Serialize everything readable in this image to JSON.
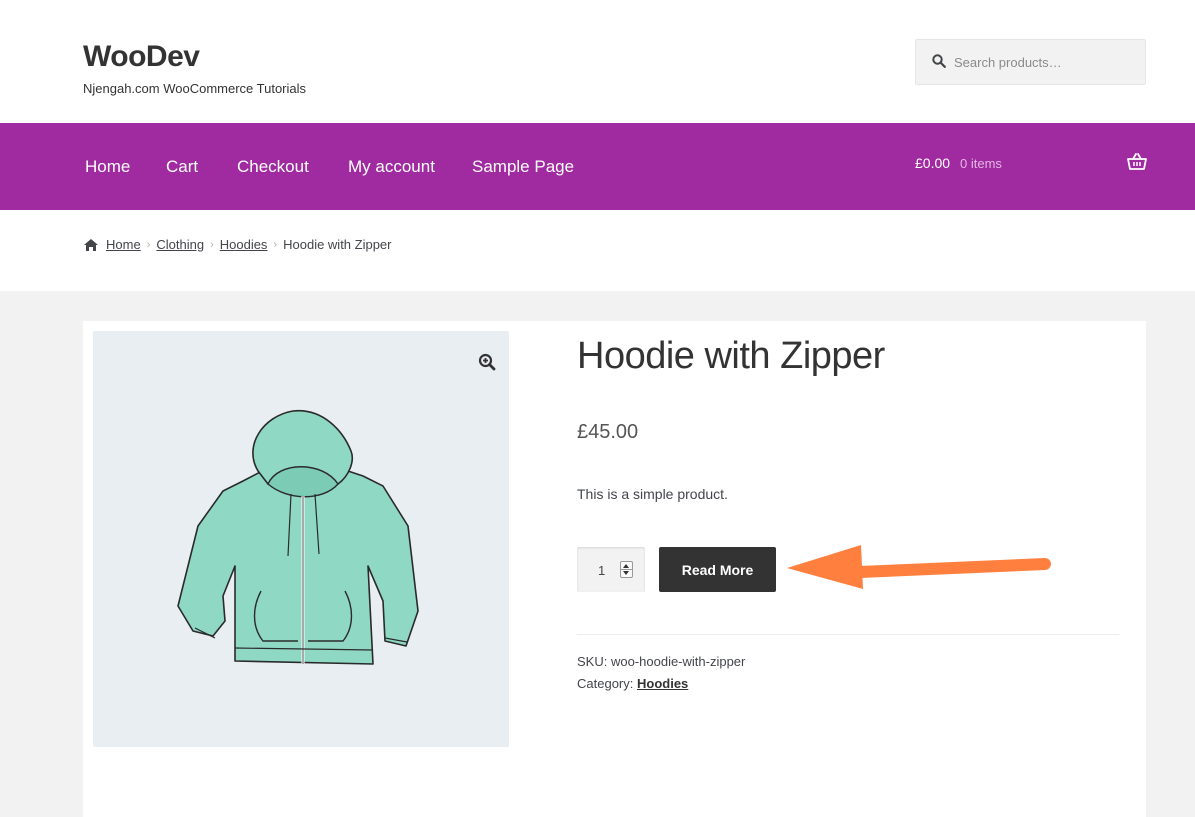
{
  "header": {
    "site_title": "WooDev",
    "site_description": "Njengah.com WooCommerce Tutorials",
    "search": {
      "placeholder": "Search products…",
      "icon": "search-icon"
    }
  },
  "nav": {
    "items": [
      {
        "label": "Home"
      },
      {
        "label": "Cart"
      },
      {
        "label": "Checkout"
      },
      {
        "label": "My account"
      },
      {
        "label": "Sample Page"
      }
    ],
    "cart": {
      "amount": "£0.00",
      "count": "0 items",
      "icon": "basket-icon"
    },
    "background": "#a02aa0"
  },
  "breadcrumb": {
    "icon": "home-icon",
    "links": [
      "Home",
      "Clothing",
      "Hoodies"
    ],
    "current": "Hoodie with Zipper"
  },
  "product": {
    "title": "Hoodie with Zipper",
    "price": "£45.00",
    "short_description": "This is a simple product.",
    "quantity": "1",
    "button_label": "Read More",
    "sku_label": "SKU:",
    "sku": "woo-hoodie-with-zipper",
    "category_label": "Category:",
    "category": "Hoodies",
    "image_icon": "zoom-icon",
    "image_color": "#8fd9c4"
  },
  "annotation": {
    "arrow_color": "#ff7f3f"
  }
}
